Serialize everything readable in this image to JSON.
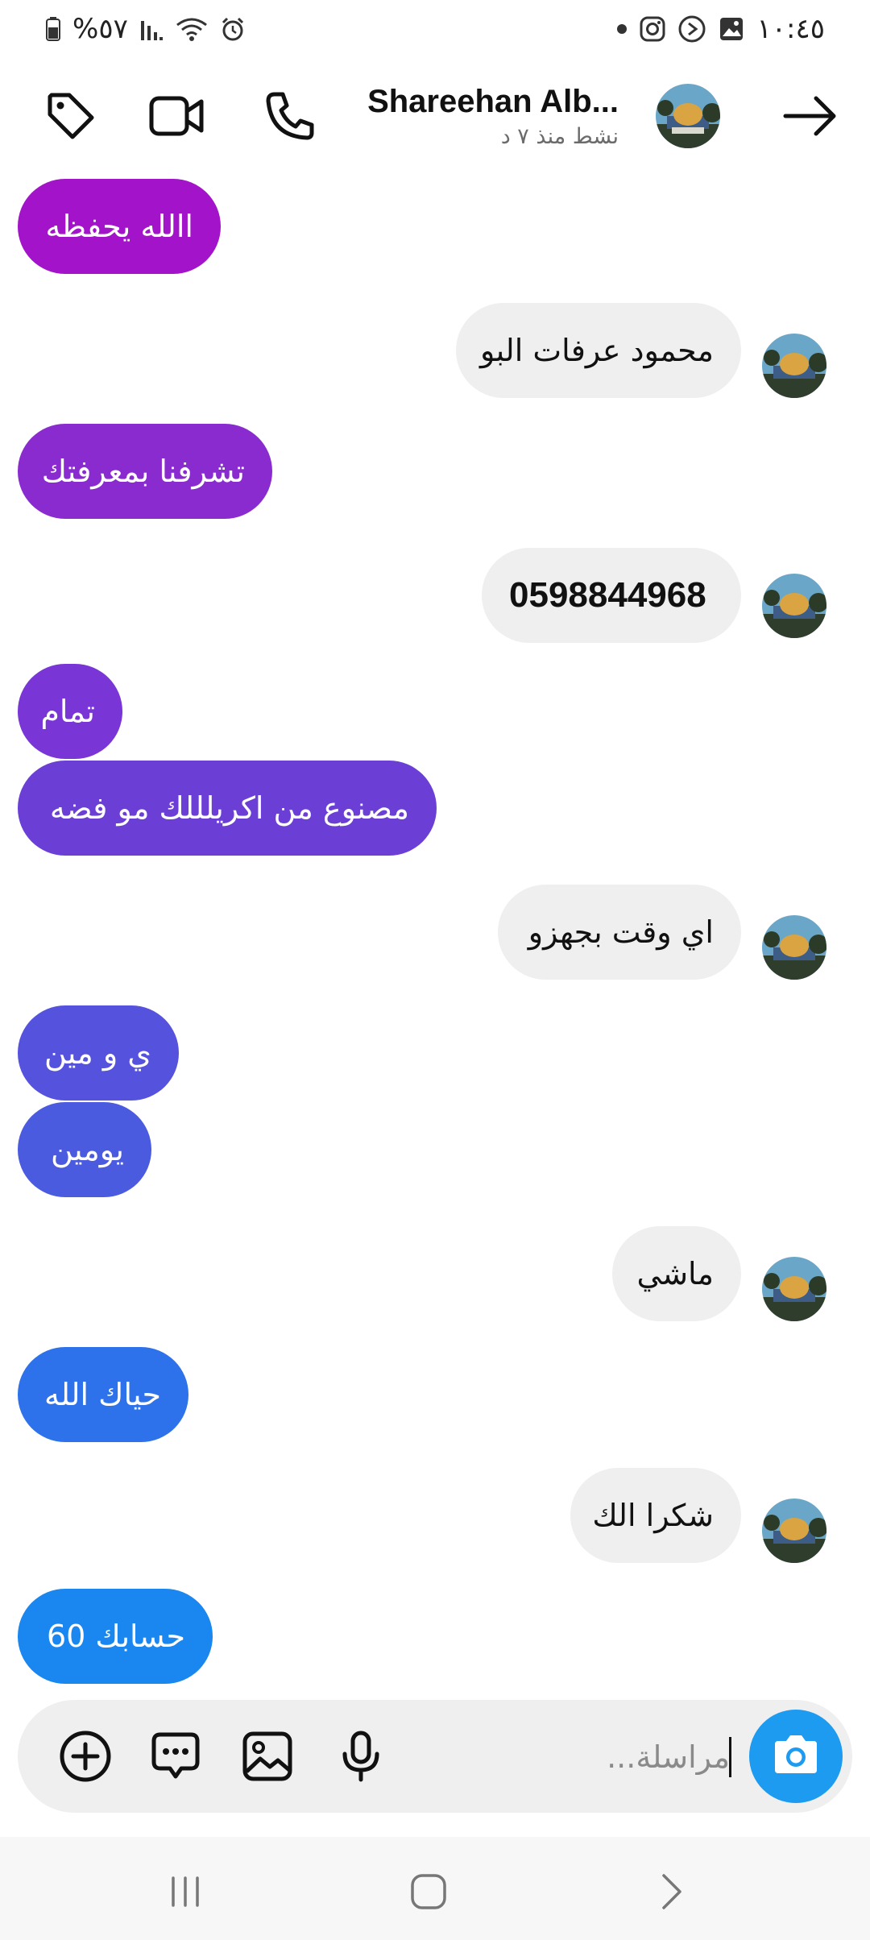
{
  "status_bar": {
    "time": "١٠:٤٥",
    "battery": "%٥٧",
    "icons_right": [
      "image-icon",
      "play-icon",
      "instagram-icon",
      "dot-icon"
    ],
    "icons_left": [
      "battery-icon",
      "signal-icon",
      "wifi-icon",
      "alarm-icon"
    ]
  },
  "header": {
    "contact_name": "Shareehan Alb...",
    "activity": "نشط منذ ٧ د",
    "back_icon": "arrow-right-icon",
    "actions": [
      "tag-icon",
      "video-call-icon",
      "phone-icon"
    ]
  },
  "messages": [
    {
      "side": "out",
      "text": "االله يحفظه",
      "color": "#a313c9"
    },
    {
      "side": "in",
      "text": "محمود عرفات البو"
    },
    {
      "side": "out",
      "text": "تشرفنا بمعرفتك",
      "color": "#8a2bd0"
    },
    {
      "side": "in",
      "text": "0598844968"
    },
    {
      "side": "out",
      "text": "تمام",
      "color": "#7a35d6"
    },
    {
      "side": "out",
      "text": "مصنوع من اكريلللك مو فضه",
      "color": "#6b3fd6"
    },
    {
      "side": "in",
      "text": "اي وقت بجهزو"
    },
    {
      "side": "out",
      "text": "ي و مين",
      "color": "#5552de"
    },
    {
      "side": "out",
      "text": "يومين",
      "color": "#4b5be0"
    },
    {
      "side": "in",
      "text": "ماشي"
    },
    {
      "side": "out",
      "text": "حياك الله",
      "color": "#2d72ea"
    },
    {
      "side": "in",
      "text": "شكرا الك"
    },
    {
      "side": "out",
      "text": "حسابك 60",
      "color": "#1a86ef"
    }
  ],
  "composer": {
    "placeholder": "مراسلة...",
    "value": "",
    "camera_color": "#1d9bf0",
    "tools": [
      "add-icon",
      "chat-bubble-icon",
      "gallery-icon",
      "microphone-icon"
    ]
  },
  "nav_bar": {
    "buttons": [
      "recents-icon",
      "home-icon",
      "back-icon"
    ]
  }
}
